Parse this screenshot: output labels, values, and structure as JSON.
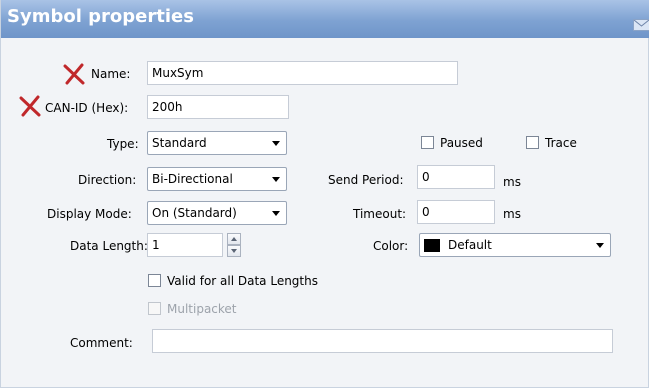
{
  "dialog": {
    "title": "Symbol properties"
  },
  "fields": {
    "name": {
      "label": "Name:",
      "value": "MuxSym"
    },
    "can_id": {
      "label": "CAN-ID (Hex):",
      "value": "200h"
    },
    "type": {
      "label": "Type:",
      "value": "Standard"
    },
    "direction": {
      "label": "Direction:",
      "value": "Bi-Directional"
    },
    "display_mode": {
      "label": "Display Mode:",
      "value": "On (Standard)"
    },
    "data_length": {
      "label": "Data Length:",
      "value": "1"
    },
    "paused": {
      "label": "Paused",
      "checked": false
    },
    "trace": {
      "label": "Trace",
      "checked": false
    },
    "send_period": {
      "label": "Send Period:",
      "value": "0",
      "unit": "ms"
    },
    "timeout": {
      "label": "Timeout:",
      "value": "0",
      "unit": "ms"
    },
    "color": {
      "label": "Color:",
      "value": "Default",
      "swatch": "#000000"
    },
    "valid_all_lengths": {
      "label": "Valid for all Data Lengths",
      "checked": false
    },
    "multipacket": {
      "label": "Multipacket",
      "checked": false,
      "enabled": false
    },
    "comment": {
      "label": "Comment:",
      "value": ""
    }
  },
  "icons": {
    "required_marker": "red-x-icon",
    "corner": "envelope-icon"
  },
  "colors": {
    "title_bar": "#7ea2d2",
    "required_marker": "#c0282b"
  }
}
